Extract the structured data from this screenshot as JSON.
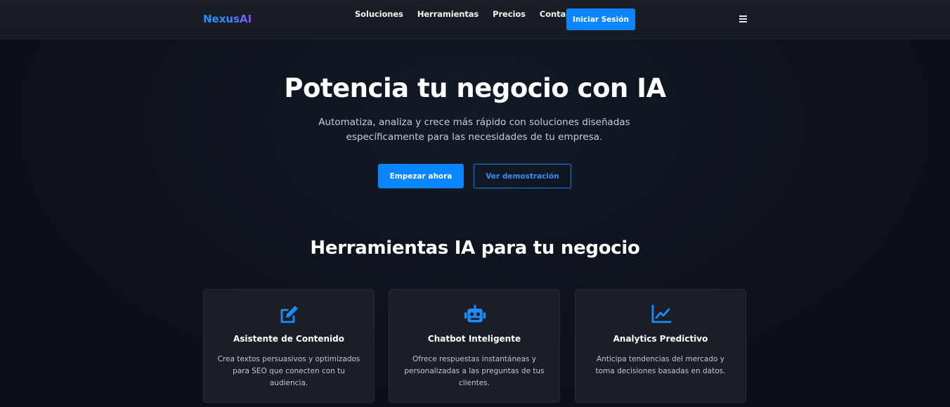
{
  "nav": {
    "logo": "NexusAI",
    "links": [
      "Soluciones",
      "Herramientas",
      "Precios",
      "Contacto"
    ],
    "login_label": "Iniciar Sesión",
    "menu_icon": "hamburger-menu-icon"
  },
  "hero": {
    "title": "Potencia tu negocio con IA",
    "subtitle": "Automatiza, analiza y crece más rápido con soluciones diseñadas específicamente para las necesidades de tu empresa.",
    "primary_label": "Empezar ahora",
    "secondary_label": "Ver demostración"
  },
  "tools": {
    "title": "Herramientas IA para tu negocio",
    "cards": [
      {
        "icon": "edit-icon",
        "title": "Asistente de Contenido",
        "desc": "Crea textos persuasivos y optimizados para SEO que conecten con tu audiencia."
      },
      {
        "icon": "robot-icon",
        "title": "Chatbot Inteligente",
        "desc": "Ofrece respuestas instantáneas y personalizadas a las preguntas de tus clientes."
      },
      {
        "icon": "chart-line-icon",
        "title": "Analytics Predictivo",
        "desc": "Anticipa tendencias del mercado y toma decisiones basadas en datos."
      }
    ]
  },
  "colors": {
    "accent": "#0a84ff",
    "background": "#0d1119",
    "card": "#1a1f27"
  }
}
